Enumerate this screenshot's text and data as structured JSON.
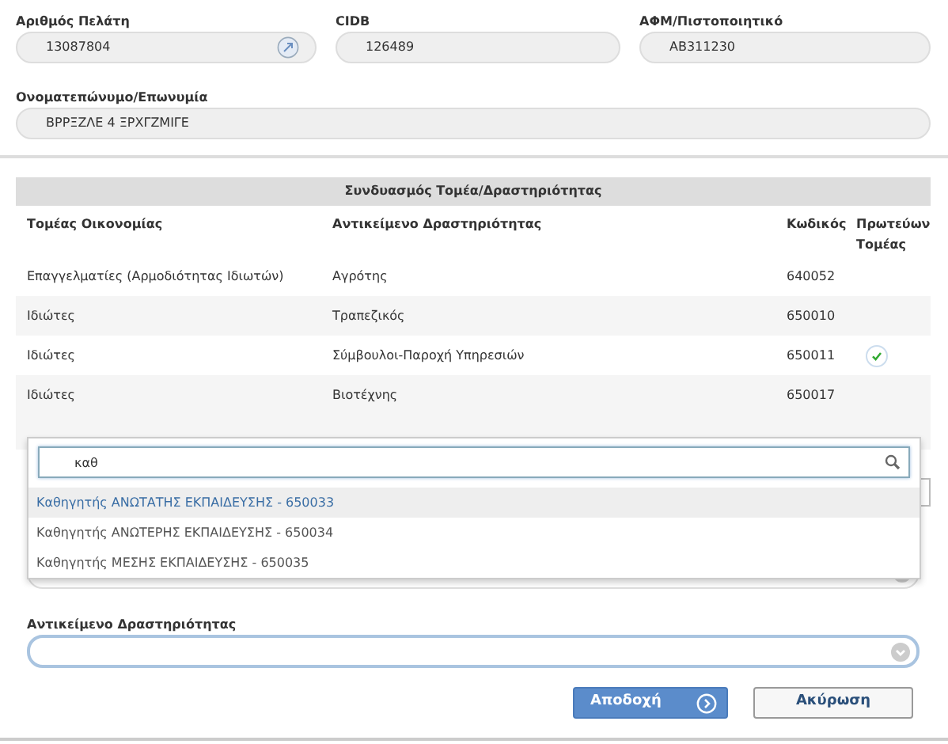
{
  "customer_fields": [
    {
      "label": "Αριθμός Πελάτη",
      "value": "13087804",
      "kind": "link"
    },
    {
      "label": "CIDB",
      "value": "126489",
      "kind": "plain"
    },
    {
      "label": "ΑΦΜ/Πιστοποιητικό",
      "value": "ΑΒ311230",
      "kind": "plain"
    }
  ],
  "name_field": {
    "label": "Ονοματεπώνυμο/Επωνυμία",
    "value": "ΒΡΡΞΖΛΕ  4 ΞΡΧΓΖΜΙΓΕ"
  },
  "table": {
    "title": "Συνδυασμός Τομέα/Δραστηριότητας",
    "columns": [
      "Τομέας Οικονομίας",
      "Αντικείμενο Δραστηριότητας",
      "Κωδικός",
      "Πρωτεύων Τομέας"
    ],
    "rows": [
      {
        "sector": "Επαγγελματίες (Αρμοδιότητας Ιδιωτών)",
        "activity": "Αγρότης",
        "code": "640052",
        "primary": false
      },
      {
        "sector": "Ιδιώτες",
        "activity": "Τραπεζικός",
        "code": "650010",
        "primary": false
      },
      {
        "sector": "Ιδιώτες",
        "activity": "Σύμβουλοι-Παροχή Υπηρεσιών",
        "code": "650011",
        "primary": true
      },
      {
        "sector": "Ιδιώτες",
        "activity": "Βιοτέχνης",
        "code": "650017",
        "primary": false
      }
    ]
  },
  "dropdown": {
    "search_value": "καθ",
    "options": [
      {
        "label": "Καθηγητής ΑΝΩΤΑΤΗΣ ΕΚΠΑΙΔΕΥΣΗΣ - 650033",
        "selected": true
      },
      {
        "label": "Καθηγητής ΑΝΩΤΕΡΗΣ ΕΚΠΑΙΔΕΥΣΗΣ - 650034",
        "selected": false
      },
      {
        "label": "Καθηγητής ΜΕΣΗΣ ΕΚΠΑΙΔΕΥΣΗΣ - 650035",
        "selected": false
      }
    ]
  },
  "activity_select": {
    "label": "Αντικείμενο Δραστηριότητας"
  },
  "buttons": [
    {
      "label": "Αποδοχή",
      "kind": "primary"
    },
    {
      "label": "Ακύρωση",
      "kind": "secondary"
    }
  ]
}
